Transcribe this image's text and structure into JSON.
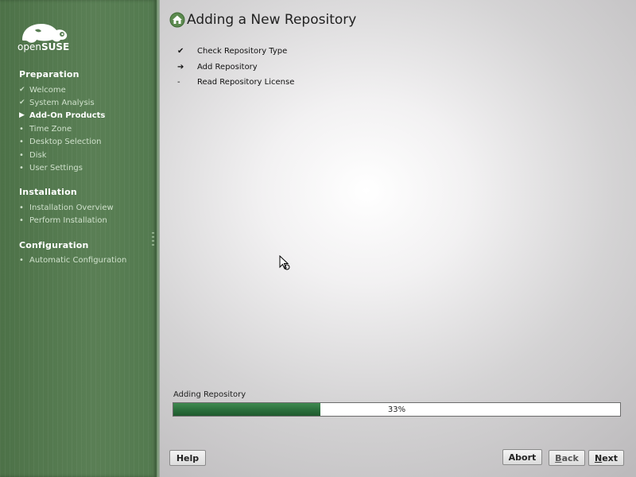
{
  "logo": {
    "text_prefix": "open",
    "text_brand": "SUSE"
  },
  "sidebar": {
    "sections": [
      {
        "title": "Preparation",
        "steps": [
          {
            "label": "Welcome",
            "state": "done"
          },
          {
            "label": "System Analysis",
            "state": "done"
          },
          {
            "label": "Add-On Products",
            "state": "current"
          },
          {
            "label": "Time Zone",
            "state": "todo"
          },
          {
            "label": "Desktop Selection",
            "state": "todo"
          },
          {
            "label": "Disk",
            "state": "todo"
          },
          {
            "label": "User Settings",
            "state": "todo"
          }
        ]
      },
      {
        "title": "Installation",
        "steps": [
          {
            "label": "Installation Overview",
            "state": "todo"
          },
          {
            "label": "Perform Installation",
            "state": "todo"
          }
        ]
      },
      {
        "title": "Configuration",
        "steps": [
          {
            "label": "Automatic Configuration",
            "state": "todo"
          }
        ]
      }
    ],
    "marks": {
      "done": "✔",
      "current": "▶",
      "todo": "•"
    }
  },
  "main": {
    "title": "Adding a New Repository",
    "tasks": [
      {
        "label": "Check Repository Type",
        "mark": "✔"
      },
      {
        "label": "Add Repository",
        "mark": "➔"
      },
      {
        "label": "Read Repository License",
        "mark": "-"
      }
    ],
    "progress": {
      "label": "Adding Repository",
      "percent": 33,
      "text": "33%"
    }
  },
  "buttons": {
    "help": "Help",
    "abort": "Abort",
    "back_mnemonic": "B",
    "back_rest": "ack",
    "next_mnemonic": "N",
    "next_rest": "ext"
  },
  "colors": {
    "sidebar": "#567b51",
    "progress_fill": "#2a6e3b"
  }
}
